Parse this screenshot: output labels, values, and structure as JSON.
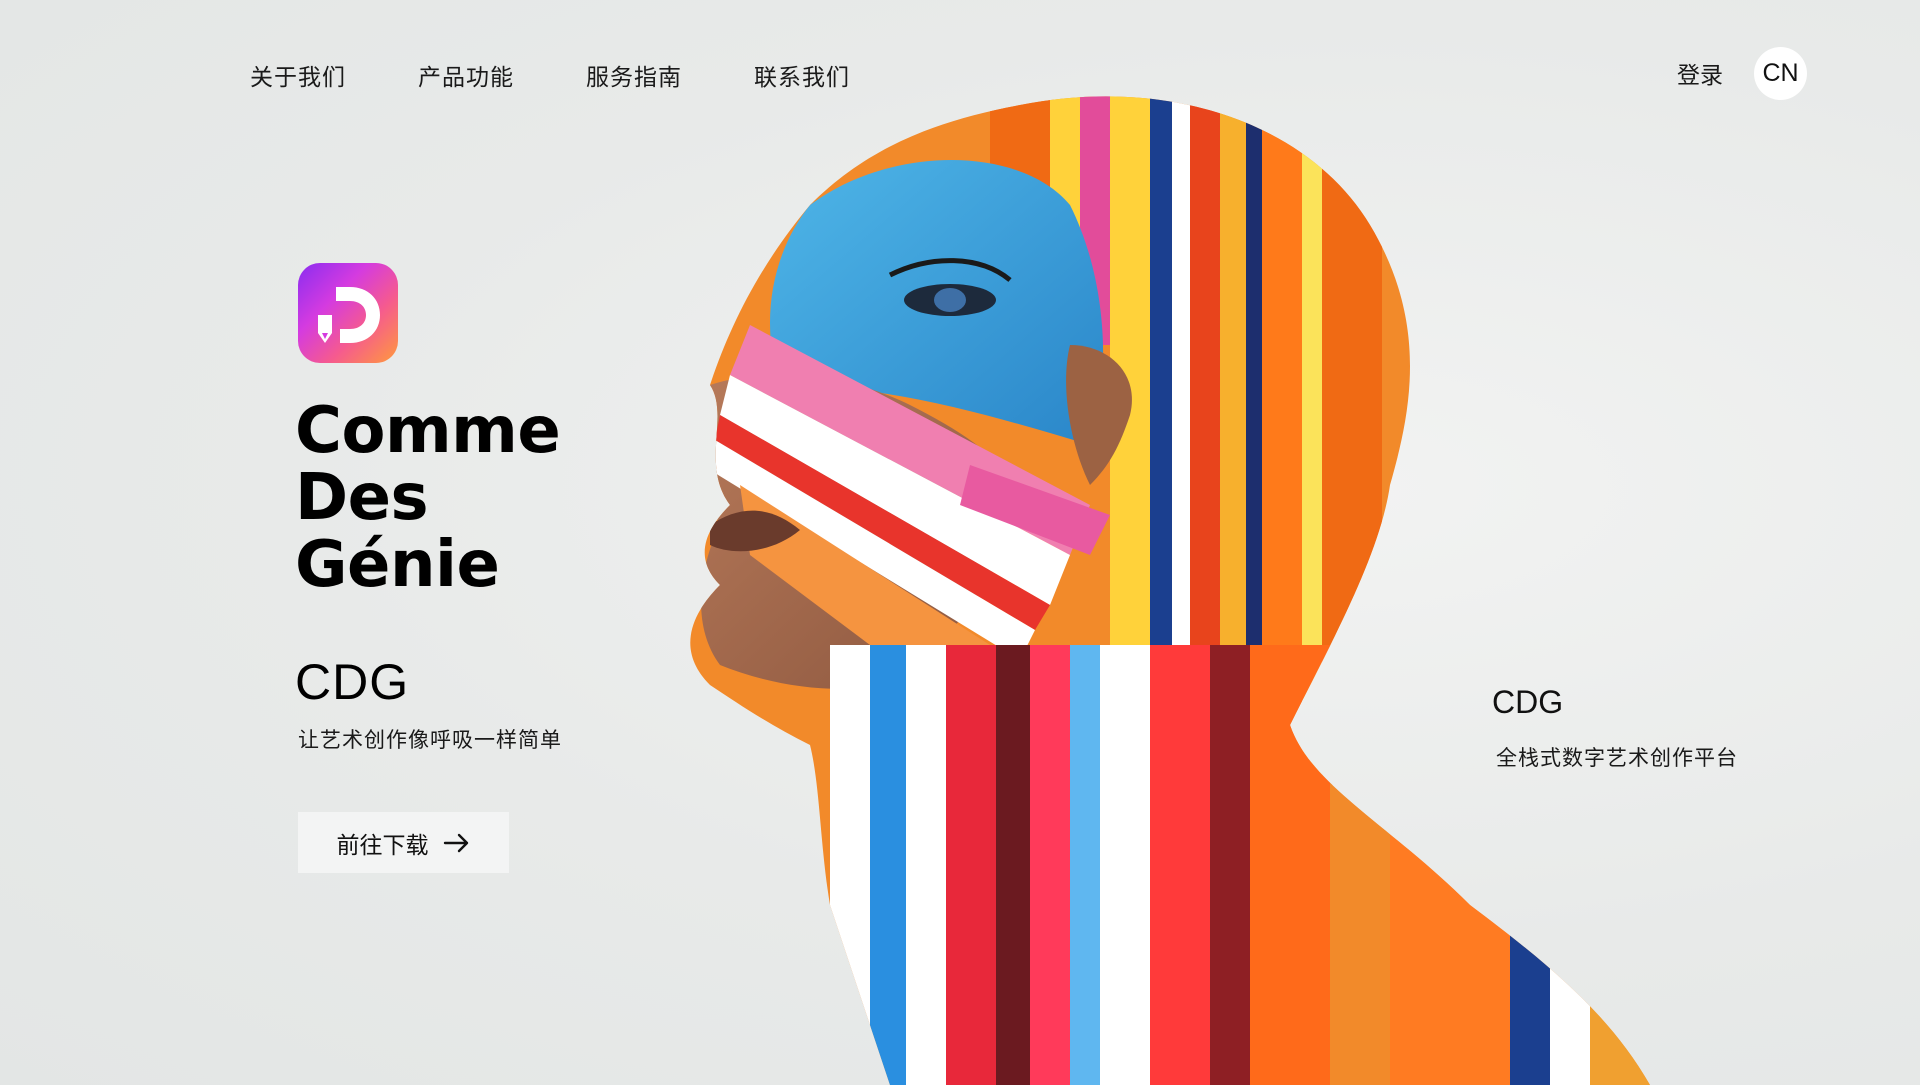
{
  "nav": {
    "items": [
      {
        "label": "关于我们"
      },
      {
        "label": "产品功能"
      },
      {
        "label": "服务指南"
      },
      {
        "label": "联系我们"
      }
    ],
    "login_label": "登录",
    "language_label": "CN"
  },
  "hero": {
    "title_lines": [
      "Comme",
      "Des",
      "Génie"
    ],
    "abbreviation": "CDG",
    "tagline": "让艺术创作像呼吸一样简单",
    "download_label": "前往下载",
    "download_icon": "arrow-right-icon"
  },
  "side": {
    "abbreviation": "CDG",
    "description": "全栈式数字艺术创作平台"
  },
  "colors": {
    "background": "#e9ebea",
    "logo_gradient": [
      "#8a2df0",
      "#d43be0",
      "#f55a8f",
      "#ff9a3c"
    ],
    "button_bg": "#f3f4f4",
    "text": "#111111"
  },
  "icons": {
    "logo": "app-logo-icon",
    "arrow": "arrow-right-icon"
  }
}
